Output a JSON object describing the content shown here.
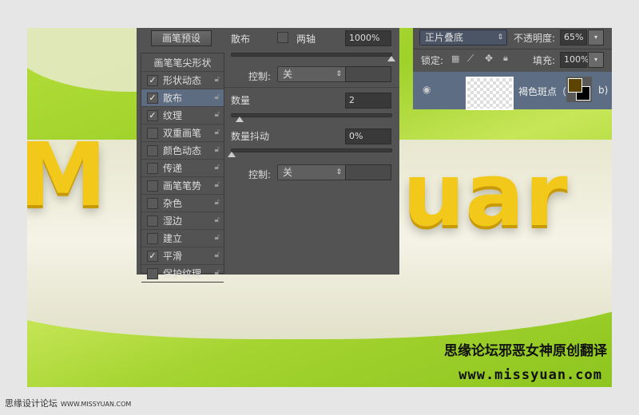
{
  "brush_panel": {
    "preset_button": "画笔预设",
    "tip_shape_header": "画笔笔尖形状",
    "items": [
      {
        "label": "形状动态",
        "checked": true
      },
      {
        "label": "散布",
        "checked": true,
        "selected": true
      },
      {
        "label": "纹理",
        "checked": true
      },
      {
        "label": "双重画笔",
        "checked": false
      },
      {
        "label": "颜色动态",
        "checked": false
      },
      {
        "label": "传递",
        "checked": false
      },
      {
        "label": "画笔笔势",
        "checked": false
      },
      {
        "label": "杂色",
        "checked": false
      },
      {
        "label": "湿边",
        "checked": false
      },
      {
        "label": "建立",
        "checked": false
      },
      {
        "label": "平滑",
        "checked": true
      },
      {
        "label": "保护纹理",
        "checked": false
      }
    ],
    "scatter_label": "散布",
    "both_axes_label": "两轴",
    "scatter_value": "1000%",
    "scatter_percent": 100,
    "control_label": "控制:",
    "control_value": "关",
    "count_label": "数量",
    "count_value": "2",
    "count_percent": 5,
    "count_jitter_label": "数量抖动",
    "count_jitter_value": "0%",
    "count_jitter_percent": 0,
    "control2_label": "控制:",
    "control2_value": "关"
  },
  "layers_panel": {
    "blend_mode": "正片叠底",
    "opacity_label": "不透明度:",
    "opacity_value": "65%",
    "lock_label": "锁定:",
    "fill_label": "填充:",
    "fill_value": "100%",
    "layer_name": "褐色斑点（：",
    "layer_suffix": "b)",
    "swatch_color": "#5b4300"
  },
  "canvas": {
    "letters_left": "M",
    "letters_right": "uar",
    "watermark_title": "思缘论坛邪恶女神原创翻译",
    "watermark_url": "www.missyuan.com"
  },
  "footer": {
    "site": "思缘设计论坛",
    "url": "WWW.MISSYUAN.COM"
  }
}
